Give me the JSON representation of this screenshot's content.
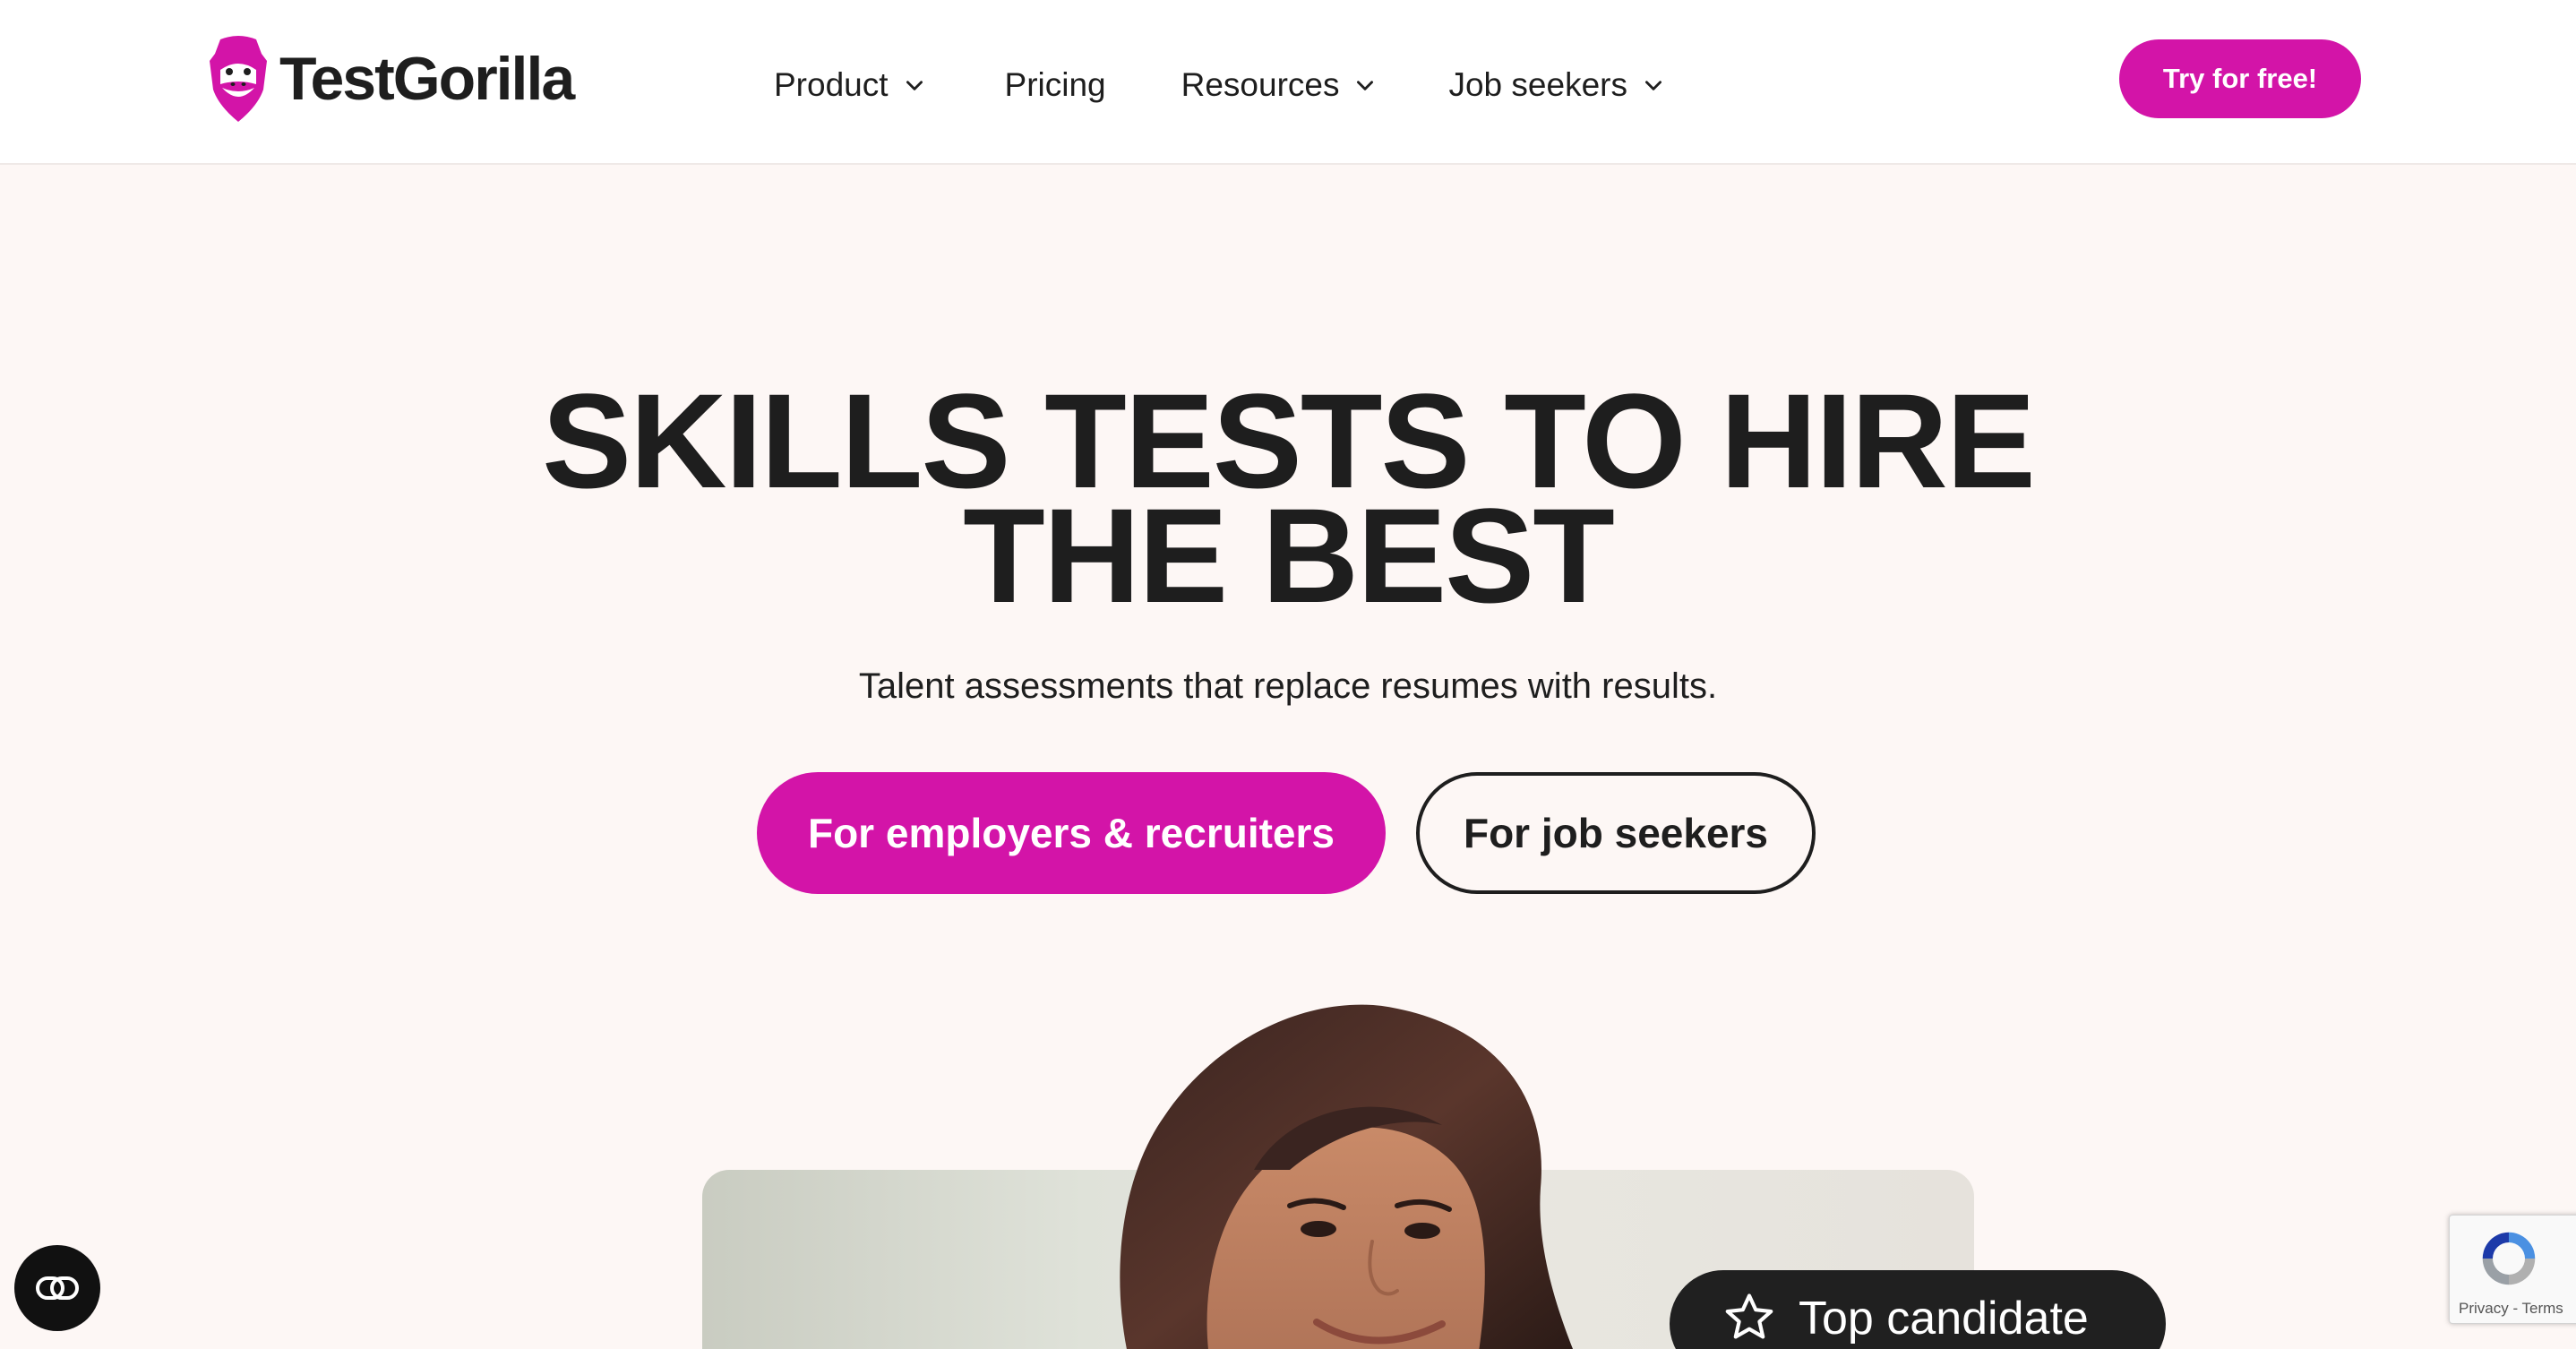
{
  "brand": {
    "name": "TestGorilla",
    "accent_color": "#d314a8",
    "logo_icon": "gorilla-logo-icon"
  },
  "nav": {
    "items": [
      {
        "label": "Product",
        "has_dropdown": true
      },
      {
        "label": "Pricing",
        "has_dropdown": false
      },
      {
        "label": "Resources",
        "has_dropdown": true
      },
      {
        "label": "Job seekers",
        "has_dropdown": true
      }
    ],
    "cta_label": "Try for free!"
  },
  "hero": {
    "title_line1": "SKILLS TESTS TO HIRE",
    "title_line2": "THE BEST",
    "subtitle": "Talent assessments that replace resumes with results.",
    "primary_button": "For employers & recruiters",
    "secondary_button": "For job seekers"
  },
  "badge": {
    "label": "Top candidate",
    "icon": "star-icon"
  },
  "widgets": {
    "accessibility_icon": "link-icon",
    "recaptcha_links": "Privacy - Terms"
  }
}
